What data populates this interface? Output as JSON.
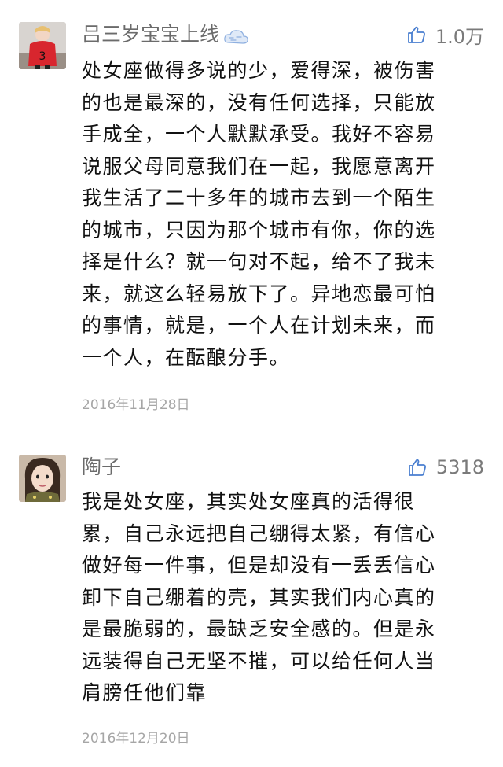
{
  "comments": [
    {
      "username": "吕三岁宝宝上线",
      "badge_icon": "cloud-badge-icon",
      "like_count": "1.0万",
      "lines": [
        "处女座做得多说的少，爱得深，被伤害",
        "的也是最深的，没有任何选择，只能放",
        "手成全，一个人默默承受。我好不容易",
        "说服父母同意我们在一起，我愿意离开",
        "我生活了二十多年的城市去到一个陌生",
        "的城市，只因为那个城市有你，你的选",
        "择是什么？就一句对不起，给不了我未",
        "来，就这么轻易放下了。异地恋最可怕",
        "的事情，就是，一个人在计划未来，而",
        "一个人，在酝酿分手。"
      ],
      "date": "2016年11月28日"
    },
    {
      "username": "陶子",
      "like_count": "5318",
      "lines": [
        "我是处女座，其实处女座真的活得很",
        "累，自己永远把自己绷得太紧，有信心",
        "做好每一件事，但是却没有一丢丢信心",
        "卸下自己绷着的壳，其实我们内心真的",
        "是最脆弱的，最缺乏安全感的。但是永",
        "远装得自己无坚不摧，可以给任何人当",
        "肩膀任他们靠"
      ],
      "date": "2016年12月20日"
    }
  ],
  "colors": {
    "username": "#6b6b6b",
    "text": "#111111",
    "date": "#a6a6a6",
    "like_icon": "#4a7fd0"
  }
}
